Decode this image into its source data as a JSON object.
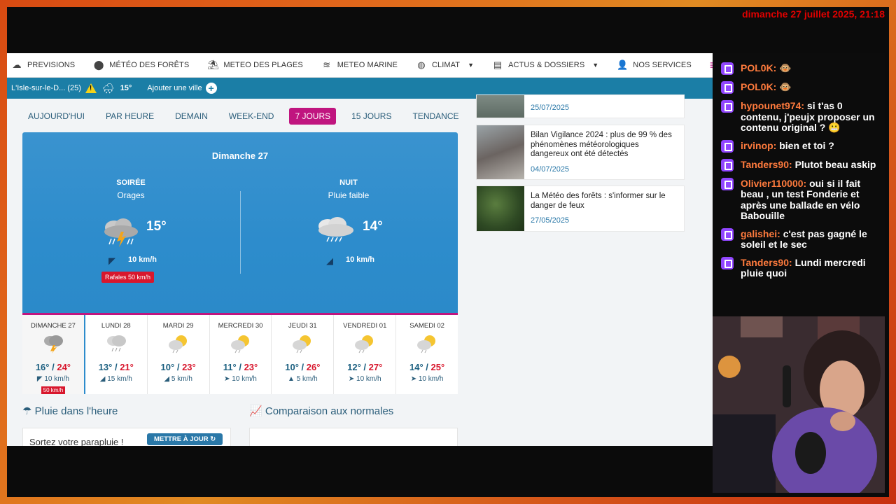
{
  "stream": {
    "date_overlay": "dimanche 27 juillet 2025, 21:18"
  },
  "nav": {
    "items": [
      {
        "label": "PREVISIONS",
        "icon": "weather-icon"
      },
      {
        "label": "MÉTÉO DES FORÊTS",
        "icon": "tree-icon"
      },
      {
        "label": "METEO DES PLAGES",
        "icon": "umbrella-beach-icon"
      },
      {
        "label": "METEO MARINE",
        "icon": "waves-icon"
      },
      {
        "label": "CLIMAT",
        "icon": "globe-icon",
        "dropdown": true
      },
      {
        "label": "ACTUS & DOSSIERS",
        "icon": "newspaper-icon",
        "dropdown": true
      },
      {
        "label": "NOS SERVICES",
        "icon": "user-plus-icon"
      }
    ]
  },
  "citybar": {
    "city": "L'Isle-sur-le-D... (25)",
    "temp": "15°",
    "add_label": "Ajouter une ville"
  },
  "tabs": [
    "AUJOURD'HUI",
    "PAR HEURE",
    "DEMAIN",
    "WEEK-END",
    "7 JOURS",
    "15 JOURS",
    "TENDANCE"
  ],
  "active_tab": "7 JOURS",
  "hero": {
    "title": "Dimanche 27",
    "periods": [
      {
        "name": "SOIRÉE",
        "desc": "Orages",
        "temp": "15°",
        "wind": "10 km/h",
        "gust": "Rafales 50 km/h"
      },
      {
        "name": "NUIT",
        "desc": "Pluie faible",
        "temp": "14°",
        "wind": "10 km/h"
      }
    ]
  },
  "days": [
    {
      "name": "DIMANCHE 27",
      "lo": "16°",
      "hi": "24°",
      "wind": "10 km/h",
      "gust": "50 km/h",
      "icon": "storm-icon"
    },
    {
      "name": "LUNDI 28",
      "lo": "13°",
      "hi": "21°",
      "wind": "15 km/h",
      "icon": "rain-cloud-icon"
    },
    {
      "name": "MARDI 29",
      "lo": "10°",
      "hi": "23°",
      "wind": "5 km/h",
      "icon": "sun-cloud-icon"
    },
    {
      "name": "MERCREDI 30",
      "lo": "11°",
      "hi": "23°",
      "wind": "10 km/h",
      "icon": "sun-cloud-icon"
    },
    {
      "name": "JEUDI 31",
      "lo": "10°",
      "hi": "26°",
      "wind": "5 km/h",
      "icon": "sun-cloud-icon"
    },
    {
      "name": "VENDREDI 01",
      "lo": "12°",
      "hi": "27°",
      "wind": "10 km/h",
      "icon": "sun-cloud-icon"
    },
    {
      "name": "SAMEDI 02",
      "lo": "14°",
      "hi": "25°",
      "wind": "10 km/h",
      "icon": "sun-cloud-icon"
    }
  ],
  "sections": {
    "rain": "Pluie dans l'heure",
    "rain_text": "Sortez votre parapluie !",
    "update_btn": "METTRE À JOUR",
    "compare": "Comparaison aux normales"
  },
  "articles": [
    {
      "title": "",
      "date": "25/07/2025"
    },
    {
      "title": "Bilan Vigilance 2024 : plus de 99 % des phénomènes météorologiques dangereux ont été détectés",
      "date": "04/07/2025"
    },
    {
      "title": "La Météo des forêts : s'informer sur le danger de feux",
      "date": "27/05/2025"
    }
  ],
  "chat": [
    {
      "user": "POL0K:",
      "text": "🐵"
    },
    {
      "user": "POL0K:",
      "text": "🐵"
    },
    {
      "user": "hypounet974:",
      "text": "si t'as 0 contenu, j'peujx proposer un contenu original ? 😬"
    },
    {
      "user": "irvinop:",
      "text": "bien et toi ?"
    },
    {
      "user": "Tanders90:",
      "text": "Plutot beau askip"
    },
    {
      "user": "Olivier110000:",
      "text": "oui si il fait beau , un test Fonderie et après une ballade en vélo Babouille"
    },
    {
      "user": "galishei:",
      "text": "c'est pas gagné le soleil et le sec"
    },
    {
      "user": "Tanders90:",
      "text": "Lundi mercredi pluie quoi"
    }
  ]
}
